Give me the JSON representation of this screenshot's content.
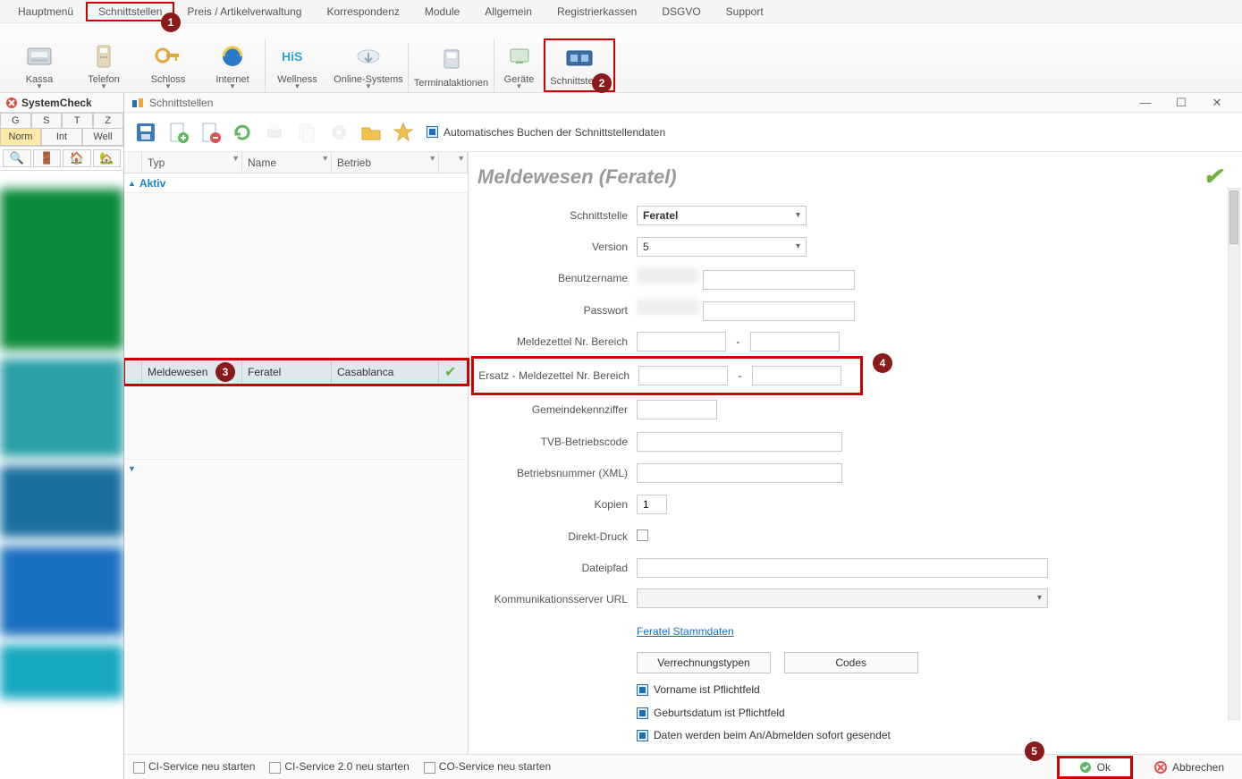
{
  "menu": {
    "items": [
      "Hauptmenü",
      "Schnittstellen",
      "Preis / Artikelverwaltung",
      "Korrespondenz",
      "Module",
      "Allgemein",
      "Registrierkassen",
      "DSGVO",
      "Support"
    ],
    "highlight_index": 1
  },
  "ribbon": {
    "items": [
      {
        "label": "Kassa",
        "icon": "cash-register",
        "dropdown": true
      },
      {
        "label": "Telefon",
        "icon": "phone",
        "dropdown": true
      },
      {
        "label": "Schloss",
        "icon": "key",
        "dropdown": true
      },
      {
        "label": "Internet",
        "icon": "browser",
        "dropdown": true
      },
      {
        "label": "Wellness",
        "icon": "wellness",
        "dropdown": true
      },
      {
        "label": "Online-Systems",
        "icon": "cloud",
        "dropdown": true
      },
      {
        "label": "Terminalaktionen",
        "icon": "terminal",
        "dropdown": false
      },
      {
        "label": "Geräte",
        "icon": "device",
        "dropdown": true
      },
      {
        "label": "Schnittstellen",
        "icon": "interfaces",
        "dropdown": false
      }
    ],
    "highlight_index": 8
  },
  "badges": {
    "b1": "1",
    "b2": "2",
    "b3": "3",
    "b4": "4",
    "b5": "5"
  },
  "syscheck": {
    "title": "SystemCheck",
    "tabs1": [
      "G",
      "S",
      "T",
      "Z"
    ],
    "tabs2": [
      "Norm",
      "Int",
      "Well"
    ],
    "active_tab2_index": 0
  },
  "window": {
    "title": "Schnittstellen"
  },
  "toolbar": {
    "auto_label": "Automatisches Buchen der Schnittstellendaten"
  },
  "grid": {
    "cols": {
      "typ": "Typ",
      "name": "Name",
      "betrieb": "Betrieb"
    },
    "group": "Aktiv",
    "row": {
      "typ": "Meldewesen",
      "name": "Feratel",
      "betrieb": "Casablanca"
    }
  },
  "form": {
    "title": "Meldewesen (Feratel)",
    "labels": {
      "schnittstelle": "Schnittstelle",
      "version": "Version",
      "benutzername": "Benutzername",
      "passwort": "Passwort",
      "mz": "Meldezettel Nr. Bereich",
      "ersatz": "Ersatz - Meldezettel Nr. Bereich",
      "gkz": "Gemeindekennziffer",
      "tvb": "TVB-Betriebscode",
      "bnr": "Betriebsnummer (XML)",
      "kopien": "Kopien",
      "direkt": "Direkt-Druck",
      "pfad": "Dateipfad",
      "kom": "Kommunikationsserver URL"
    },
    "values": {
      "schnittstelle": "Feratel",
      "version": "5",
      "kopien": "1"
    },
    "dash": "-",
    "link": "Feratel Stammdaten",
    "btn1": "Verrechnungstypen",
    "btn2": "Codes",
    "check1": "Vorname ist Pflichtfeld",
    "check2": "Geburtsdatum ist Pflichtfeld",
    "check3": "Daten werden beim An/Abmelden sofort gesendet"
  },
  "footer": {
    "c1": "CI-Service neu starten",
    "c2": "CI-Service 2.0 neu starten",
    "c3": "CO-Service neu starten",
    "ok": "Ok",
    "cancel": "Abbrechen"
  }
}
